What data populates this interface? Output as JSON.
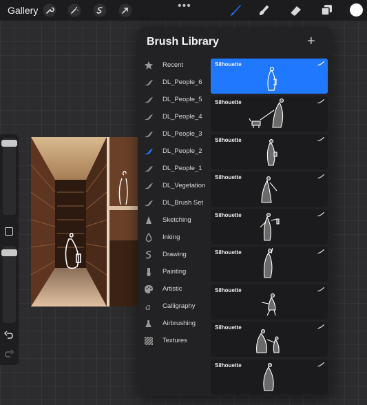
{
  "topbar": {
    "gallery_label": "Gallery",
    "more_label": "•••",
    "tools": [
      "wrench-icon",
      "magic-wand-icon",
      "selection-icon",
      "transform-arrow-icon"
    ],
    "right_tools": [
      "brush-icon",
      "smudge-icon",
      "eraser-icon",
      "layers-icon"
    ],
    "active_tool": "brush",
    "colors": {
      "accent": "#1f78ff",
      "current_color": "#ffffff"
    }
  },
  "library": {
    "title": "Brush Library",
    "add_label": "+",
    "categories": [
      {
        "label": "Recent",
        "icon": "star-icon"
      },
      {
        "label": "DL_People_6",
        "icon": "brush-stroke-icon"
      },
      {
        "label": "DL_People_5",
        "icon": "brush-stroke-icon"
      },
      {
        "label": "DL_People_4",
        "icon": "brush-stroke-icon"
      },
      {
        "label": "DL_People_3",
        "icon": "brush-stroke-icon"
      },
      {
        "label": "DL_People_2",
        "icon": "brush-stroke-icon",
        "selected": true
      },
      {
        "label": "DL_People_1",
        "icon": "brush-stroke-icon"
      },
      {
        "label": "DL_Vegetation",
        "icon": "brush-stroke-icon"
      },
      {
        "label": "DL_Brush Set",
        "icon": "brush-stroke-icon"
      },
      {
        "label": "Sketching",
        "icon": "pencil-tip-icon"
      },
      {
        "label": "Inking",
        "icon": "ink-drop-icon"
      },
      {
        "label": "Drawing",
        "icon": "squiggle-icon"
      },
      {
        "label": "Painting",
        "icon": "paintbrush-icon"
      },
      {
        "label": "Artistic",
        "icon": "palette-icon"
      },
      {
        "label": "Calligraphy",
        "icon": "calligraphy-icon"
      },
      {
        "label": "Airbrushing",
        "icon": "airbrush-icon"
      },
      {
        "label": "Textures",
        "icon": "texture-icon"
      }
    ],
    "brushes": [
      {
        "name": "Silhouette",
        "selected": true
      },
      {
        "name": "Silhouette"
      },
      {
        "name": "Silhouette"
      },
      {
        "name": "Silhouette"
      },
      {
        "name": "Silhouette"
      },
      {
        "name": "Silhouette"
      },
      {
        "name": "Silhouette"
      },
      {
        "name": "Silhouette"
      },
      {
        "name": "Silhouette"
      }
    ]
  }
}
